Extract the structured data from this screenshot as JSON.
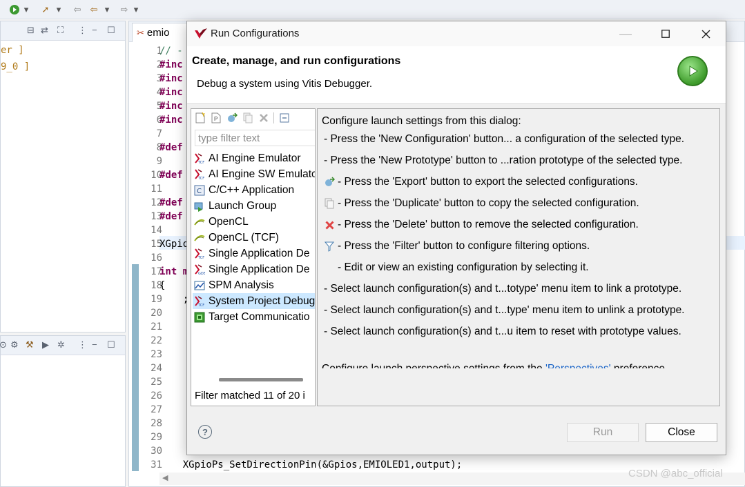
{
  "ide": {
    "left_tree": [
      "er ]",
      "9_0 ]"
    ],
    "editor_tab": "emio",
    "line_numbers": [
      "1",
      "2",
      "3",
      "4",
      "5",
      "6",
      "7",
      "8",
      "9",
      "10",
      "11",
      "12",
      "13",
      "14",
      "15",
      "16",
      "17",
      "18",
      "19",
      "20",
      "21",
      "22",
      "23",
      "24",
      "25",
      "26",
      "27",
      "28",
      "29",
      "30",
      "31"
    ],
    "code": {
      "l1": "// -",
      "l2": "#inc",
      "l3": "#inc",
      "l4": "#inc",
      "l5": "#inc",
      "l6": "#inc",
      "l8": "#def",
      "l10": "#def",
      "l12": "#def",
      "l13": "#def",
      "l15": "XGpio",
      "l17": "int m",
      "l18": "{",
      "l19": "    ;",
      "l31": "    XGpioPs_SetDirectionPin(&Gpios,EMIOLED1,output);"
    }
  },
  "dialog": {
    "title": "Run Configurations",
    "header_title": "Create, manage, and run configurations",
    "header_subtitle": "Debug a system using Vitis Debugger.",
    "filter_placeholder": "type filter text",
    "configs": [
      {
        "label": "AI Engine Emulator",
        "icon": "tcf-icon",
        "selected": false
      },
      {
        "label": "AI Engine SW Emulato",
        "icon": "tcf-icon",
        "selected": false
      },
      {
        "label": "C/C++ Application",
        "icon": "c-app-icon",
        "selected": false
      },
      {
        "label": "Launch Group",
        "icon": "launch-group-icon",
        "selected": false
      },
      {
        "label": "OpenCL",
        "icon": "opencl-icon",
        "selected": false
      },
      {
        "label": "OpenCL (TCF)",
        "icon": "opencl-icon",
        "selected": false
      },
      {
        "label": "Single Application De",
        "icon": "tcf-icon",
        "selected": false
      },
      {
        "label": "Single Application De",
        "icon": "gdb-icon",
        "selected": false
      },
      {
        "label": "SPM Analysis",
        "icon": "spm-icon",
        "selected": false
      },
      {
        "label": "System Project Debug",
        "icon": "tcf-icon",
        "selected": true
      },
      {
        "label": "Target Communicatio",
        "icon": "target-comm-icon",
        "selected": false
      }
    ],
    "filter_status": "Filter matched 11 of 20 i",
    "intro": "Configure launch settings from this dialog:",
    "instructions": [
      {
        "icon": "",
        "text": "- Press the 'New Configuration' button... a configuration of the selected type."
      },
      {
        "icon": "",
        "text": "- Press the 'New Prototype' button to ...ration prototype of the selected type."
      },
      {
        "icon": "export-icon",
        "text": "- Press the 'Export' button to export the selected configurations."
      },
      {
        "icon": "duplicate-icon",
        "text": "- Press the 'Duplicate' button to copy the selected configuration."
      },
      {
        "icon": "delete-icon",
        "text": "- Press the 'Delete' button to remove the selected configuration."
      },
      {
        "icon": "filter-icon",
        "text": "- Press the 'Filter' button to configure filtering options."
      },
      {
        "icon": "blank",
        "text": "- Edit or view an existing configuration by selecting it."
      },
      {
        "icon": "",
        "text": "- Select launch configuration(s) and t...totype' menu item to link a prototype."
      },
      {
        "icon": "",
        "text": "- Select launch configuration(s) and t...type' menu item to unlink a prototype."
      },
      {
        "icon": "",
        "text": "- Select launch configuration(s) and t...u item to reset with prototype values."
      }
    ],
    "perspective_prefix": "Configure launch perspective settings from the ",
    "perspective_link": "'Perspectives'",
    "perspective_suffix": " preference",
    "run_label": "Run",
    "close_label": "Close"
  },
  "watermark": "CSDN @abc_official"
}
